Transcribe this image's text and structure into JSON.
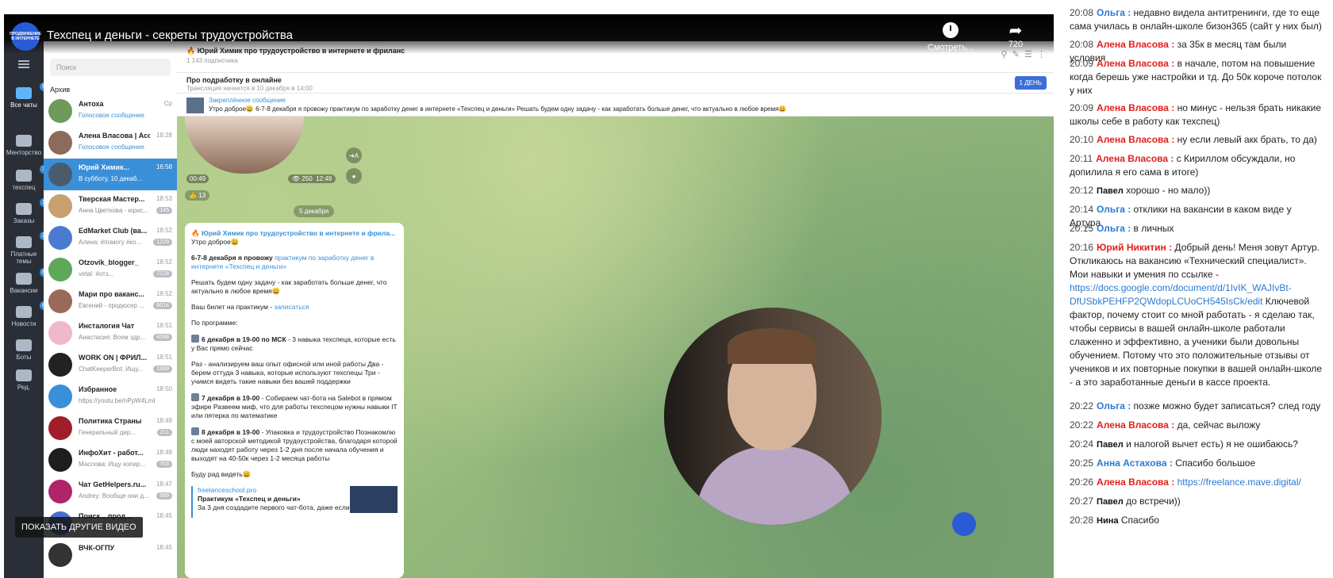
{
  "player": {
    "channel_logo_text": "ПРОДВИЖЕНИЕ В ИНТЕРНЕТЕ",
    "title": "Техспец и деньги - секреты трудоустройства",
    "watch_later_label": "Смотреть...",
    "quality": "720",
    "show_more_label": "ПОКАЗАТЬ ДРУГИЕ ВИДЕО"
  },
  "telegram": {
    "rail": [
      {
        "label": "Все чаты",
        "badge": "99+"
      },
      {
        "label": "Менторство",
        "badge": ""
      },
      {
        "label": "техспец",
        "badge": "1"
      },
      {
        "label": "Заказы",
        "badge": "1"
      },
      {
        "label": "Платные темы",
        "badge": "2"
      },
      {
        "label": "Вакансии",
        "badge": "8"
      },
      {
        "label": "Новости",
        "badge": "8"
      },
      {
        "label": "Боты",
        "badge": ""
      },
      {
        "label": "Ред.",
        "badge": ""
      }
    ],
    "search_placeholder": "Поиск",
    "archive_label": "Архив",
    "chats": [
      {
        "name": "Антоха",
        "time": "Ср",
        "preview": "Голосовое сообщение",
        "count": "",
        "color": "#6e9a5a"
      },
      {
        "name": "Алена Власова | Асс...",
        "time": "18:28",
        "preview": "Голосовое сообщение",
        "count": "",
        "color": "#8b6b5a"
      },
      {
        "name": "Юрий Химик...",
        "time": "16:58",
        "preview": "В субботу, 10 декаб...",
        "count": "",
        "color": "#4a5b6e"
      },
      {
        "name": "Тверская Мастер...",
        "time": "18:53",
        "preview": "Анна Цветкова - юрис...",
        "count": "145",
        "color": "#c8a070"
      },
      {
        "name": "EdMarket Club (ва...",
        "time": "18:52",
        "preview": "Алина: #помогу #ко...",
        "count": "1229",
        "color": "#4a7bd0"
      },
      {
        "name": "Otzovik_blogger_",
        "time": "18:52",
        "preview": "vetal: #отз...",
        "count": "7128",
        "color": "#5fa85a"
      },
      {
        "name": "Мари про ваканс...",
        "time": "18:52",
        "preview": "Евгений - продюсер ...",
        "count": "6014",
        "color": "#9a6a58"
      },
      {
        "name": "Инсталогия Чат",
        "time": "18:51",
        "preview": "Анастасия: Всем здр...",
        "count": "4048",
        "color": "#f0b8c8"
      },
      {
        "name": "WORK ON | ФРИЛ...",
        "time": "18:51",
        "preview": "ChatKeeperBot: Ищу...",
        "count": "1569",
        "color": "#222222"
      },
      {
        "name": "Избранное",
        "time": "18:50",
        "preview": "https://youtu.be/nPpW4LmE...",
        "count": "",
        "color": "#3a8fd9"
      },
      {
        "name": "Политика Страны",
        "time": "18:49",
        "preview": "Генеральный дир...",
        "count": "211",
        "color": "#a01e2a"
      },
      {
        "name": "ИнфоХит - работ...",
        "time": "18:48",
        "preview": "Маслова: Ищу копир...",
        "count": "703",
        "color": "#1e1e1e"
      },
      {
        "name": "Чат GetHelpers.ru...",
        "time": "18:47",
        "preview": "Andrey: Вообще они д...",
        "count": "989",
        "color": "#b0246a"
      },
      {
        "name": "Поиск... прод...",
        "time": "18:45",
        "preview": "...ов доступно)",
        "count": "",
        "color": "#4a6fd0"
      },
      {
        "name": "ВЧК-ОГПУ",
        "time": "18:45",
        "preview": "",
        "count": "",
        "color": "#333333"
      }
    ],
    "channel": {
      "name": "🔥 Юрий Химик про трудоустройство в интернете и фриланс",
      "subscribers": "1 143 подписчика"
    },
    "stream": {
      "title": "Про подработку в онлайне",
      "subtitle": "Трансляция начнется в 10 декабря в 14:00",
      "button": "1 ДЕНЬ"
    },
    "pinned": {
      "label": "Закреплённое сообщение",
      "text": "Утро доброе😀 6-7-8 декабря я провожу практикум по заработку денег в интернете «Техспец и деньги» Решать будем одну задачу - как заработать больше денег, что актуально в любое время😀"
    },
    "video_note": {
      "duration": "00:49",
      "views": "250",
      "time": "12:49",
      "reactions": "13"
    },
    "date_divider": "5 декабря",
    "message": {
      "header": "🔥 Юрий Химик про трудоустройство в интернете и фрила...",
      "greeting": "Утро доброе😀",
      "intro_bold": "6-7-8 декабря я провожу",
      "intro_link": "практикум по заработку денег в интернете «Техспец и деньги»",
      "task": "Решать будем одну задачу - как заработать больше денег, что актуально в любое время😀",
      "ticket_text": "Ваш билет на практикум -",
      "ticket_link": "записаться",
      "program": "По программе:",
      "day1_bold": "6 декабря в 19-00 по МСК",
      "day1_text": "- 3 навыка техспеца, которые есть у Вас прямо сейчас",
      "day1_list": "Раз - анализируем ваш опыт офисной или иной работы Два - берем оттуда 3 навыка, которые используют техспецы Три - учимся видеть такие навыки без вашей поддержки",
      "day2_bold": "7 декабря в 19-00",
      "day2_text": "- Собираем чат-бота на Salebot в прямом эфире Развеем миф, что для работы техспецом нужны навыки IT или пятерка по математике",
      "day3_bold": "8 декабря в 19-00",
      "day3_text": "- Упаковка и трудоустройство Познакомлю с моей авторской методикой трудоустройства, благодаря которой люди находят работу через 1-2 дня после начала обучения и выходят на 40-50к через 1-2 месяца работы",
      "closing": "Буду рад видеть😀",
      "preview_site": "freelanceschool.pro",
      "preview_title": "Практикум «Техспец и деньги»",
      "preview_text": "За 3 дня создадите первого чат-бота, даже если"
    }
  },
  "live_chat": [
    {
      "time": "20:08",
      "author": "Ольга",
      "sep": ":",
      "color": "blue",
      "text": "недавно видела антитренинги, где то еще сама училась в онлайн-школе бизон365 (сайт у них был)"
    },
    {
      "time": "20:08",
      "author": "Алена Власова",
      "sep": ":",
      "color": "red",
      "text": "за 35к в месяц там были условия"
    },
    {
      "time": "20:09",
      "author": "Алена Власова",
      "sep": ":",
      "color": "red",
      "text": "в начале, потом на повышение когда берешь уже настройки и тд. До 50к короче потолок у них"
    },
    {
      "time": "20:09",
      "author": "Алена Власова",
      "sep": ":",
      "color": "red",
      "text": "но минус - нельзя брать никакие школы себе в работу как техспец)"
    },
    {
      "time": "20:10",
      "author": "Алена Власова",
      "sep": ":",
      "color": "red",
      "text": "ну если левый акк брать, то да)"
    },
    {
      "time": "20:11",
      "author": "Алена Власова",
      "sep": ":",
      "color": "red",
      "text": "с Кириллом обсуждали, но допилила я его сама в итоге)"
    },
    {
      "time": "20:12",
      "author": "Павел",
      "sep": "",
      "color": "black",
      "text": "хорошо - но мало))"
    },
    {
      "time": "20:14",
      "author": "Ольга",
      "sep": ":",
      "color": "blue",
      "text": "отклики на вакансии в каком виде у Артура"
    },
    {
      "time": "20:15",
      "author": "Ольга",
      "sep": ":",
      "color": "blue",
      "text": "в личных"
    },
    {
      "time": "20:16",
      "author": "Юрий Никитин",
      "sep": ":",
      "color": "red",
      "text": "Добрый день! Меня зовут Артур. Откликаюсь на вакансию «Технический специалист». Мои навыки и умения по ссылке -",
      "link": "https://docs.google.com/document/d/1IvIK_WAJIvBt-DfUSbkPEHFP2QWdopLCUoCH545IsCk/edit",
      "text2": "Ключевой фактор, почему стоит со мной работать - я сделаю так, чтобы сервисы в вашей онлайн-школе работали слаженно и эффективно, а ученики были довольны обучением. Потому что это положительные отзывы от учеников и их повторные покупки в вашей онлайн-школе - а это заработанные деньги в кассе проекта."
    },
    {
      "time": "20:22",
      "author": "Ольга",
      "sep": ":",
      "color": "blue",
      "text": "позже можно будет записаться? след году"
    },
    {
      "time": "20:22",
      "author": "Алена Власова",
      "sep": ":",
      "color": "red",
      "text": "да, сейчас выложу"
    },
    {
      "time": "20:24",
      "author": "Павел",
      "sep": "",
      "color": "black",
      "text": "и налогой вычет есть) я не ошибаюсь?"
    },
    {
      "time": "20:25",
      "author": "Анна Астахова",
      "sep": ":",
      "color": "blue",
      "text": "Спасибо большое"
    },
    {
      "time": "20:26",
      "author": "Алена Власова",
      "sep": ":",
      "color": "red",
      "text": "",
      "link": "https://freelance.mave.digital/"
    },
    {
      "time": "20:27",
      "author": "Павел",
      "sep": "",
      "color": "black",
      "text": "до встречи))"
    },
    {
      "time": "20:28",
      "author": "Нина",
      "sep": "",
      "color": "black",
      "text": "Спасибо"
    }
  ]
}
